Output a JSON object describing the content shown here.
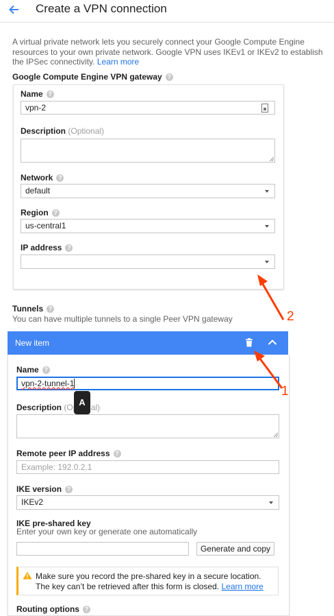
{
  "header": {
    "title": "Create a VPN connection",
    "back_icon": "arrow-back-icon"
  },
  "intro": {
    "text": "A virtual private network lets you securely connect your Google Compute Engine resources to your own private network. Google VPN uses IKEv1 or IKEv2 to establish the IPSec connectivity.",
    "link": "Learn more"
  },
  "gateway": {
    "title": "Google Compute Engine VPN gateway",
    "name": {
      "label": "Name",
      "value": "vpn-2"
    },
    "description": {
      "label": "Description",
      "optional": "(Optional)",
      "value": ""
    },
    "network": {
      "label": "Network",
      "value": "default"
    },
    "region": {
      "label": "Region",
      "value": "us-central1"
    },
    "ip_address": {
      "label": "IP address",
      "value": ""
    }
  },
  "tunnels": {
    "title": "Tunnels",
    "subtitle": "You can have multiple tunnels to a single Peer VPN gateway",
    "item_title": "New item",
    "name": {
      "label": "Name",
      "value": "vpn-2-tunnel-1"
    },
    "description": {
      "label": "Description",
      "optional": "(Optional)"
    },
    "remote_ip": {
      "label": "Remote peer IP address",
      "placeholder": "Example: 192.0.2.1"
    },
    "ike_version": {
      "label": "IKE version",
      "value": "IKEv2"
    },
    "psk": {
      "label": "IKE pre-shared key",
      "hint": "Enter your own key or generate one automatically",
      "button": "Generate and copy"
    },
    "warning": {
      "text": "Make sure you record the pre-shared key in a secure location. The key can’t be retrieved after this form is closed.",
      "link": "Learn more"
    },
    "routing": {
      "label": "Routing options"
    }
  },
  "tooltip": "A",
  "annotations": {
    "one": "1",
    "two": "2"
  },
  "colors": {
    "accent": "#4285f4",
    "link": "#1a73e8",
    "warning": "#f9ab00",
    "annotation": "#ff3d00"
  }
}
